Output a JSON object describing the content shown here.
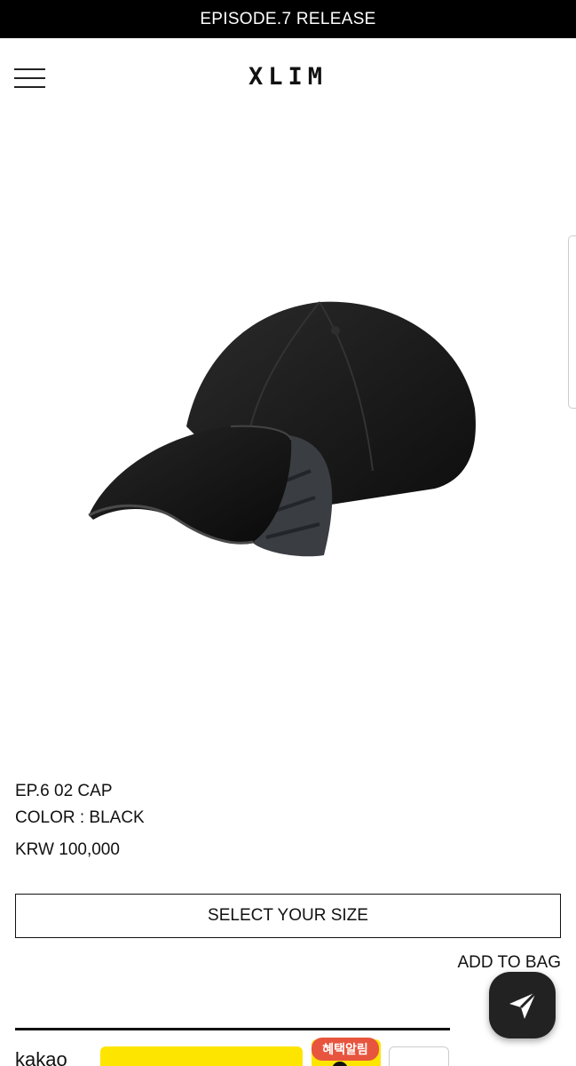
{
  "announcement": {
    "text": "EPISODE.7 RELEASE"
  },
  "header": {
    "logo": "XLIM",
    "menu_icon": "hamburger-menu-icon"
  },
  "product": {
    "image_icon": "black-cap-image",
    "name": "EP.6 02 CAP",
    "color": "COLOR : BLACK",
    "price": "KRW 100,000"
  },
  "actions": {
    "select_size": "SELECT YOUR SIZE",
    "add_to_bag": "ADD TO BAG"
  },
  "footer": {
    "kakao_label": "kakao",
    "benefit_badge": "혜택알림"
  },
  "floating_button": {
    "icon": "send-arrow-icon"
  },
  "colors": {
    "accent": "#000000",
    "kakao_yellow": "#fee500",
    "badge_red": "#e8553e"
  }
}
